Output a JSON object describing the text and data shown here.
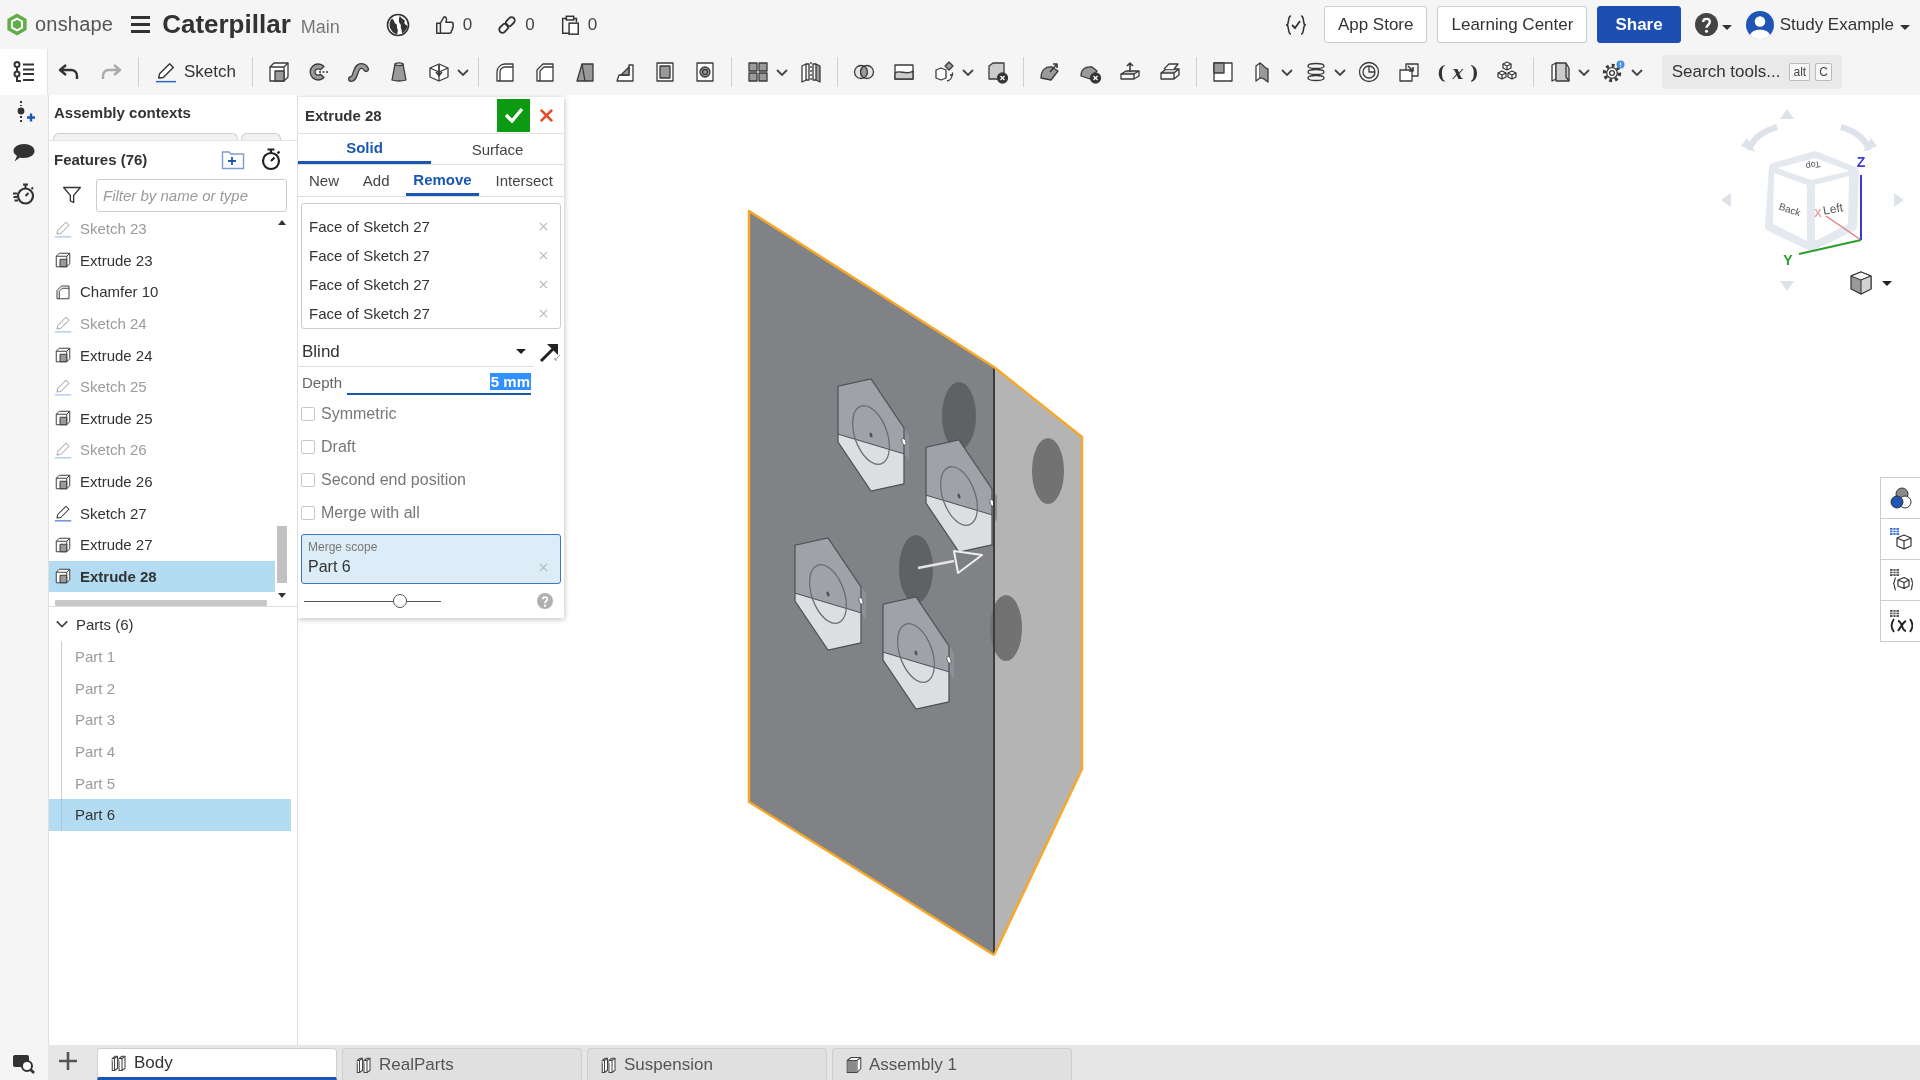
{
  "header": {
    "logo": "onshape",
    "document": "Caterpillar",
    "branch": "Main",
    "counters": [
      {
        "kind": "like",
        "count": "0"
      },
      {
        "kind": "link",
        "count": "0"
      },
      {
        "kind": "copy",
        "count": "0"
      }
    ],
    "buttons": [
      "App Store",
      "Learning Center"
    ],
    "share": "Share",
    "user": "Study Example"
  },
  "toolbar": {
    "history": [
      {
        "kind": "undo",
        "disabled": false
      },
      {
        "kind": "redo",
        "disabled": true
      }
    ],
    "sketch": "Sketch",
    "variable": "(*x*)",
    "search": {
      "label": "Search tools...",
      "keys": [
        "alt",
        "C"
      ]
    }
  },
  "feature_panel": {
    "assembly_contexts": "Assembly contexts",
    "features": {
      "title": "Features (76)",
      "filter_placeholder": "Filter by name or type",
      "items": [
        {
          "kind": "sketch",
          "name": "Sketch 23",
          "visible": false,
          "selected": false
        },
        {
          "kind": "extrude",
          "name": "Extrude 23",
          "visible": true,
          "selected": false
        },
        {
          "kind": "chamfer",
          "name": "Chamfer 10",
          "visible": true,
          "selected": false
        },
        {
          "kind": "sketch",
          "name": "Sketch 24",
          "visible": false,
          "selected": false
        },
        {
          "kind": "extrude",
          "name": "Extrude 24",
          "visible": true,
          "selected": false
        },
        {
          "kind": "sketch",
          "name": "Sketch 25",
          "visible": false,
          "selected": false
        },
        {
          "kind": "extrude",
          "name": "Extrude 25",
          "visible": true,
          "selected": false
        },
        {
          "kind": "sketch",
          "name": "Sketch 26",
          "visible": false,
          "selected": false
        },
        {
          "kind": "extrude",
          "name": "Extrude 26",
          "visible": true,
          "selected": false
        },
        {
          "kind": "sketch",
          "name": "Sketch 27",
          "visible": true,
          "selected": false
        },
        {
          "kind": "extrude",
          "name": "Extrude 27",
          "visible": true,
          "selected": false
        },
        {
          "kind": "extrude",
          "name": "Extrude 28",
          "visible": true,
          "selected": true
        }
      ]
    },
    "parts": {
      "title": "Parts (6)",
      "expanded": true,
      "items": [
        {
          "name": "Part 1",
          "visible": false,
          "selected": false
        },
        {
          "name": "Part 2",
          "visible": false,
          "selected": false
        },
        {
          "name": "Part 3",
          "visible": false,
          "selected": false
        },
        {
          "name": "Part 4",
          "visible": false,
          "selected": false
        },
        {
          "name": "Part 5",
          "visible": false,
          "selected": false
        },
        {
          "name": "Part 6",
          "visible": true,
          "selected": true
        }
      ]
    }
  },
  "feature_dialog": {
    "title": "Extrude 28",
    "body_types": [
      {
        "label": "Solid",
        "selected": true
      },
      {
        "label": "Surface",
        "selected": false
      }
    ],
    "operations": [
      {
        "label": "New",
        "selected": false
      },
      {
        "label": "Add",
        "selected": false
      },
      {
        "label": "Remove",
        "selected": true
      },
      {
        "label": "Intersect",
        "selected": false
      }
    ],
    "selections": [
      "Face of Sketch 27",
      "Face of Sketch 27",
      "Face of Sketch 27",
      "Face of Sketch 27"
    ],
    "end_type": "Blind",
    "depth": {
      "label": "Depth",
      "value": "5 mm"
    },
    "options": [
      {
        "label": "Symmetric",
        "checked": false
      },
      {
        "label": "Draft",
        "checked": false
      },
      {
        "label": "Second end position",
        "checked": false
      },
      {
        "label": "Merge with all",
        "checked": false
      }
    ],
    "merge_scope": {
      "label": "Merge scope",
      "items": [
        "Part 6"
      ]
    },
    "slider": {
      "level": 0.7
    }
  },
  "viewport": {
    "view_cube": {
      "faces": [
        "Top",
        "Back",
        "Left"
      ],
      "axes": [
        "X",
        "Y",
        "Z"
      ]
    }
  },
  "tabs": [
    {
      "label": "Body",
      "kind": "part_studio",
      "selected": true
    },
    {
      "label": "RealParts",
      "kind": "part_studio",
      "selected": false
    },
    {
      "label": "Suspension",
      "kind": "part_studio",
      "selected": false
    },
    {
      "label": "Assembly 1",
      "kind": "assembly",
      "selected": false
    }
  ]
}
